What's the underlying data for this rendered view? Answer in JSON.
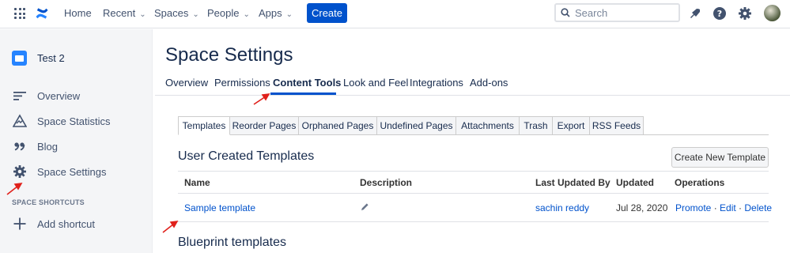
{
  "topnav": {
    "items": [
      {
        "label": "Home",
        "dropdown": false
      },
      {
        "label": "Recent",
        "dropdown": true
      },
      {
        "label": "Spaces",
        "dropdown": true
      },
      {
        "label": "People",
        "dropdown": true
      },
      {
        "label": "Apps",
        "dropdown": true
      }
    ],
    "create_label": "Create",
    "search_placeholder": "Search",
    "icons": [
      "apps-grid-icon",
      "confluence-logo-icon",
      "notification-icon",
      "help-icon",
      "settings-icon",
      "avatar"
    ]
  },
  "sidebar": {
    "space_name": "Test 2",
    "items": [
      {
        "label": "Overview",
        "icon": "overview-icon"
      },
      {
        "label": "Space Statistics",
        "icon": "statistics-icon"
      },
      {
        "label": "Blog",
        "icon": "quote-icon"
      },
      {
        "label": "Space Settings",
        "icon": "gear-icon"
      }
    ],
    "shortcuts_heading": "SPACE SHORTCUTS",
    "add_shortcut_label": "Add shortcut"
  },
  "main": {
    "title": "Space Settings",
    "tabs": [
      "Overview",
      "Permissions",
      "Content Tools",
      "Look and Feel",
      "Integrations",
      "Add-ons"
    ],
    "active_tab": "Content Tools",
    "sub_tabs": [
      "Templates",
      "Reorder Pages",
      "Orphaned Pages",
      "Undefined Pages",
      "Attachments",
      "Trash",
      "Export",
      "RSS Feeds"
    ],
    "active_sub_tab": "Templates",
    "user_templates": {
      "heading": "User Created Templates",
      "create_button": "Create New Template",
      "columns": [
        "Name",
        "Description",
        "Last Updated By",
        "Updated",
        "Operations"
      ],
      "rows": [
        {
          "name": "Sample template",
          "description_icon": "pencil-icon",
          "last_updated_by": "sachin reddy",
          "updated": "Jul 28, 2020",
          "operations": [
            "Promote",
            "Edit",
            "Delete"
          ]
        }
      ]
    },
    "blueprint_heading": "Blueprint templates"
  },
  "colors": {
    "brand": "#0052cc",
    "annotation_arrow": "#e0201b"
  }
}
